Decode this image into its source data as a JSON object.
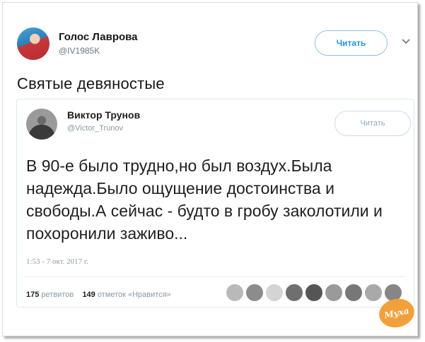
{
  "outer_tweet": {
    "author_name": "Голос Лаврова",
    "author_handle": "@IV1985K",
    "follow_label": "Читать",
    "text": "Святые девяностые"
  },
  "quoted_tweet": {
    "author_name": "Виктор Трунов",
    "author_handle": "@Victor_Trunov",
    "follow_label": "Читать",
    "text": "В 90-е было трудно,но был воздух.Была надежда.Было ощущение достоинства и свободы.А сейчас - будто в гробу заколотили и похоронили заживо...",
    "timestamp": "1:53 - 7 окт. 2017 г.",
    "retweets_count": "175",
    "retweets_label": "ретвитов",
    "likes_count": "149",
    "likes_label": "отметок «Нравится»"
  },
  "watermark": {
    "text": "Муха"
  },
  "colors": {
    "accent": "#1b95e0",
    "watermark": "#f2a03b"
  }
}
